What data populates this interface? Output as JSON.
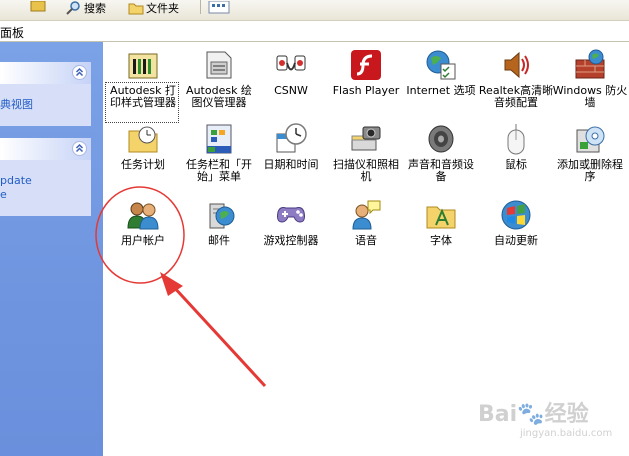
{
  "toolbar": {
    "search_label": "搜索",
    "folders_label": "文件夹"
  },
  "address": {
    "value": "面板"
  },
  "left_pane": {
    "box1_link": "典视图",
    "box2_link1": "pdate",
    "box2_link2": "e"
  },
  "items": [
    {
      "label": "Autodesk 打印样式管理器"
    },
    {
      "label": "Autodesk 绘图仪管理器"
    },
    {
      "label": "CSNW"
    },
    {
      "label": "Flash Player"
    },
    {
      "label": "Internet 选项"
    },
    {
      "label": "Realtek高清晰音频配置"
    },
    {
      "label": "Windows 防火墙"
    },
    {
      "label": "任务计划"
    },
    {
      "label": "任务栏和「开始」菜单"
    },
    {
      "label": "日期和时间"
    },
    {
      "label": "扫描仪和照相机"
    },
    {
      "label": "声音和音频设备"
    },
    {
      "label": "鼠标"
    },
    {
      "label": "添加或删除程序"
    },
    {
      "label": "用户帐户"
    },
    {
      "label": "邮件"
    },
    {
      "label": "游戏控制器"
    },
    {
      "label": "语音"
    },
    {
      "label": "字体"
    },
    {
      "label": "自动更新"
    }
  ],
  "watermark": {
    "brand": "Bai",
    "brand_cn": "经验",
    "url": "jingyan.baidu.com"
  },
  "colors": {
    "left_pane": "#7098e3",
    "link": "#215dc6",
    "annotation_red": "#e53935"
  }
}
